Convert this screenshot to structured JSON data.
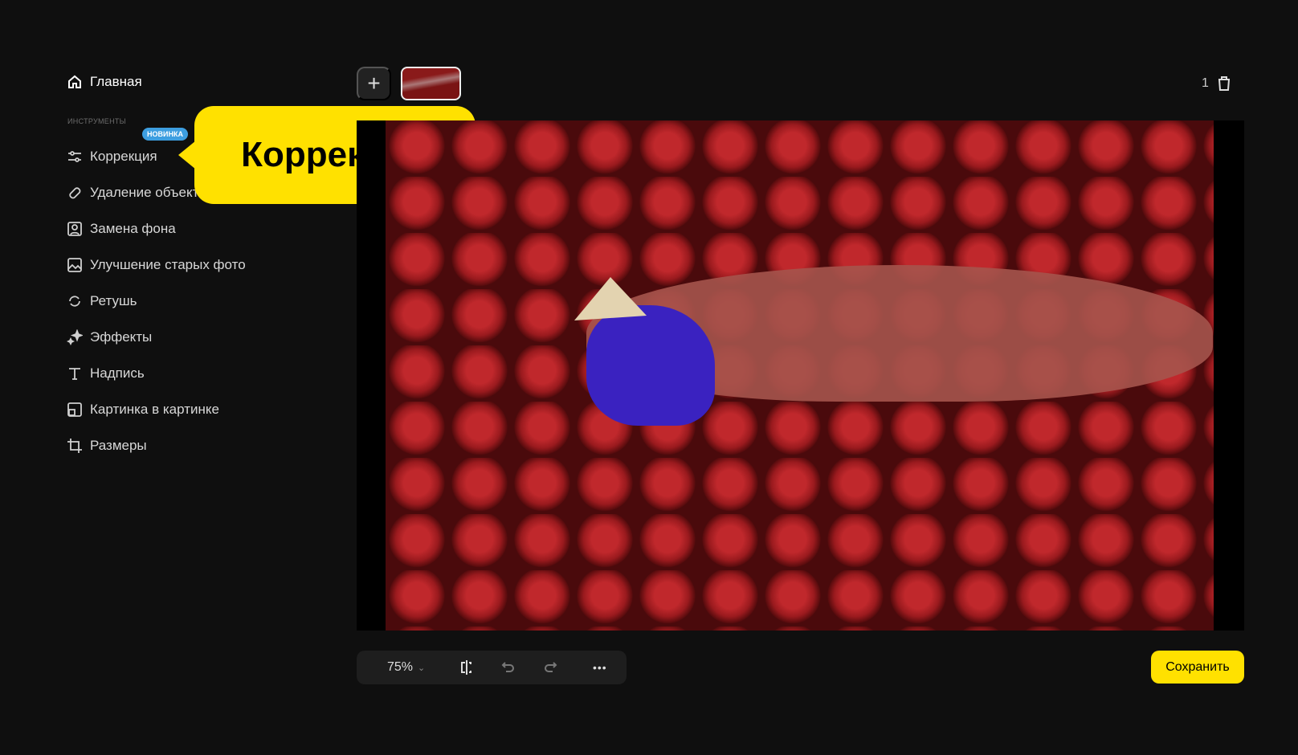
{
  "sidebar": {
    "home": "Главная",
    "section": "ИНСТРУМЕНТЫ",
    "badge": "НОВИНКА",
    "items": [
      {
        "label": "Коррекция"
      },
      {
        "label": "Удаление объектов"
      },
      {
        "label": "Замена фона"
      },
      {
        "label": "Улучшение старых фото"
      },
      {
        "label": "Ретушь"
      },
      {
        "label": "Эффекты"
      },
      {
        "label": "Надпись"
      },
      {
        "label": "Картинка в картинке"
      },
      {
        "label": "Размеры"
      }
    ]
  },
  "callout": "Коррекция",
  "header": {
    "add": "+",
    "count": "1"
  },
  "toolbar": {
    "zoom": "75%",
    "more": "•••"
  },
  "save": "Сохранить",
  "colors": {
    "accent": "#ffe100",
    "badge": "#3d9ee0"
  }
}
